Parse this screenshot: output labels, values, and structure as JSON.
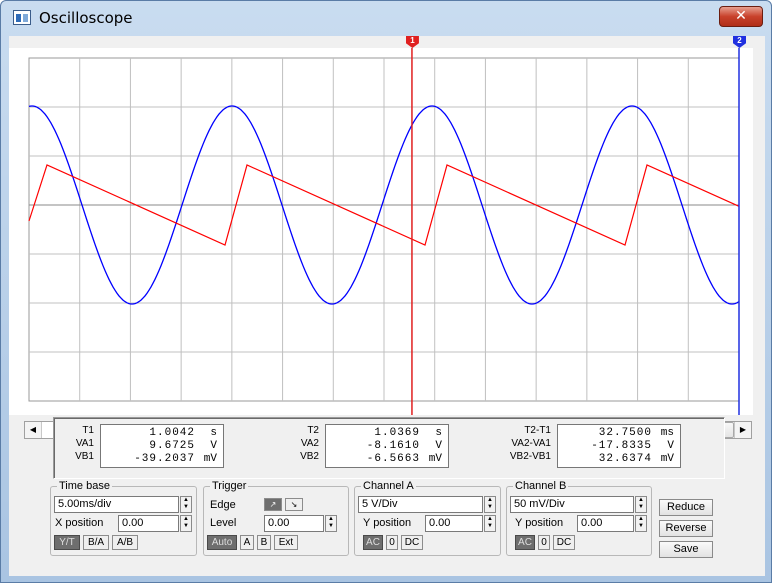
{
  "window": {
    "title": "Oscilloscope",
    "close_symbol": "✕"
  },
  "colors": {
    "channel_a_trace": "#ff0000",
    "channel_b_trace": "#0000ff",
    "cursor_t1": "#e02020",
    "cursor_t2": "#2030e0",
    "grid": "#c0c0c0"
  },
  "scope": {
    "cursor1_label": "1",
    "cursor2_label": "2",
    "channel_a_waveform": "sawtooth",
    "channel_b_waveform": "sine",
    "cursor1_position_fraction": 0.545,
    "cursor2_position_fraction": 1.0
  },
  "scroll": {
    "left_arrow": "◀",
    "right_arrow": "▶",
    "thumb_position_fraction": 0.88
  },
  "readout": {
    "t1": {
      "labels": [
        "T1",
        "VA1",
        "VB1"
      ],
      "rows": [
        {
          "value": "1.0042",
          "unit": "s"
        },
        {
          "value": "9.6725",
          "unit": "V"
        },
        {
          "value": "-39.2037",
          "unit": "mV"
        }
      ]
    },
    "t2": {
      "labels": [
        "T2",
        "VA2",
        "VB2"
      ],
      "rows": [
        {
          "value": "1.0369",
          "unit": "s"
        },
        {
          "value": "-8.1610",
          "unit": "V"
        },
        {
          "value": "-6.5663",
          "unit": "mV"
        }
      ]
    },
    "diff": {
      "labels": [
        "T2-T1",
        "VA2-VA1",
        "VB2-VB1"
      ],
      "rows": [
        {
          "value": "32.7500",
          "unit": "ms"
        },
        {
          "value": "-17.8335",
          "unit": "V"
        },
        {
          "value": "32.6374",
          "unit": "mV"
        }
      ]
    }
  },
  "timebase": {
    "legend": "Time base",
    "scale": "5.00ms/div",
    "xpos_label": "X position",
    "xpos_value": "0.00",
    "modes": [
      "Y/T",
      "B/A",
      "A/B"
    ],
    "active_mode": "Y/T"
  },
  "trigger": {
    "legend": "Trigger",
    "edge_label": "Edge",
    "edge_rising": "↗",
    "edge_falling": "↘",
    "level_label": "Level",
    "level_value": "0.00",
    "sources": [
      "Auto",
      "A",
      "B",
      "Ext"
    ],
    "active_source": "Auto"
  },
  "channel_a": {
    "legend": "Channel A",
    "scale": "5 V/Div",
    "ypos_label": "Y position",
    "ypos_value": "0.00",
    "couplings": [
      "AC",
      "0",
      "DC"
    ],
    "active_coupling": "AC"
  },
  "channel_b": {
    "legend": "Channel B",
    "scale": "50 mV/Div",
    "ypos_label": "Y position",
    "ypos_value": "0.00",
    "couplings": [
      "AC",
      "0",
      "DC"
    ],
    "active_coupling": "AC"
  },
  "actions": {
    "reduce": "Reduce",
    "reverse": "Reverse",
    "save": "Save"
  }
}
